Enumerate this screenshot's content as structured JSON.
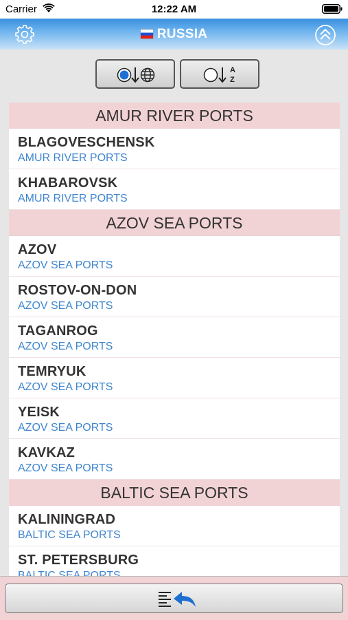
{
  "status": {
    "carrier": "Carrier",
    "time": "12:22 AM"
  },
  "nav": {
    "title": "RUSSIA",
    "flag": "russia-flag",
    "left_icon": "gear-icon",
    "right_icon": "chevron-up-circle-icon"
  },
  "sort_toggle": {
    "options": [
      {
        "icon": "sort-by-region-icon",
        "selected": true
      },
      {
        "icon": "sort-alphabetical-icon",
        "selected": false
      }
    ],
    "letters_a": "A",
    "letters_z": "Z"
  },
  "sections": [
    {
      "header": "AMUR RIVER PORTS",
      "rows": [
        {
          "name": "BLAGOVESCHENSK",
          "sub": "AMUR RIVER PORTS"
        },
        {
          "name": "KHABAROVSK",
          "sub": "AMUR RIVER PORTS"
        }
      ]
    },
    {
      "header": "AZOV SEA PORTS",
      "rows": [
        {
          "name": "AZOV",
          "sub": "AZOV SEA PORTS"
        },
        {
          "name": "ROSTOV-ON-DON",
          "sub": "AZOV SEA PORTS"
        },
        {
          "name": "TAGANROG",
          "sub": "AZOV SEA PORTS"
        },
        {
          "name": "TEMRYUK",
          "sub": "AZOV SEA PORTS"
        },
        {
          "name": "YEISK",
          "sub": "AZOV SEA PORTS"
        },
        {
          "name": "KAVKAZ",
          "sub": "AZOV SEA PORTS"
        }
      ]
    },
    {
      "header": "BALTIC SEA PORTS",
      "rows": [
        {
          "name": "KALININGRAD",
          "sub": "BALTIC SEA PORTS"
        },
        {
          "name": "ST. PETERSBURG",
          "sub": "BALTIC SEA PORTS"
        }
      ]
    }
  ],
  "bottom": {
    "icon": "back-to-list-icon"
  },
  "colors": {
    "accent_blue": "#3f86cf",
    "section_pink": "#f2d3d5",
    "nav_blue": "#3a8fdc"
  }
}
